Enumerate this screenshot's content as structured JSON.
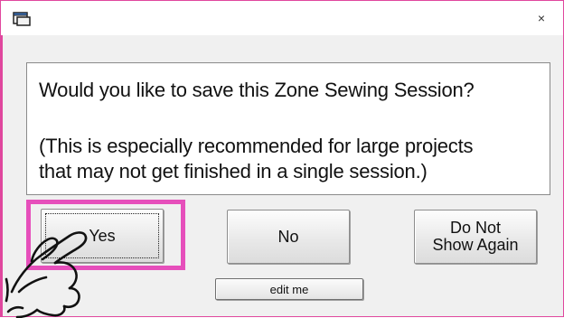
{
  "window": {
    "close_glyph": "×"
  },
  "message": {
    "question": "Would you like to save this Zone Sewing Session?",
    "detail_line1": "(This is especially recommended for large projects",
    "detail_line2": "that may not get finished in a single session.)"
  },
  "buttons": {
    "yes": "Yes",
    "no": "No",
    "do_not_show_line1": "Do Not",
    "do_not_show_line2": "Show Again",
    "edit": "edit me"
  },
  "colors": {
    "highlight": "#e64fbb",
    "window_border": "#e0479e",
    "dialog_bg": "#f0f0f0"
  },
  "icons": [
    "window-app-icon",
    "close-icon",
    "pointing-hand-icon"
  ]
}
